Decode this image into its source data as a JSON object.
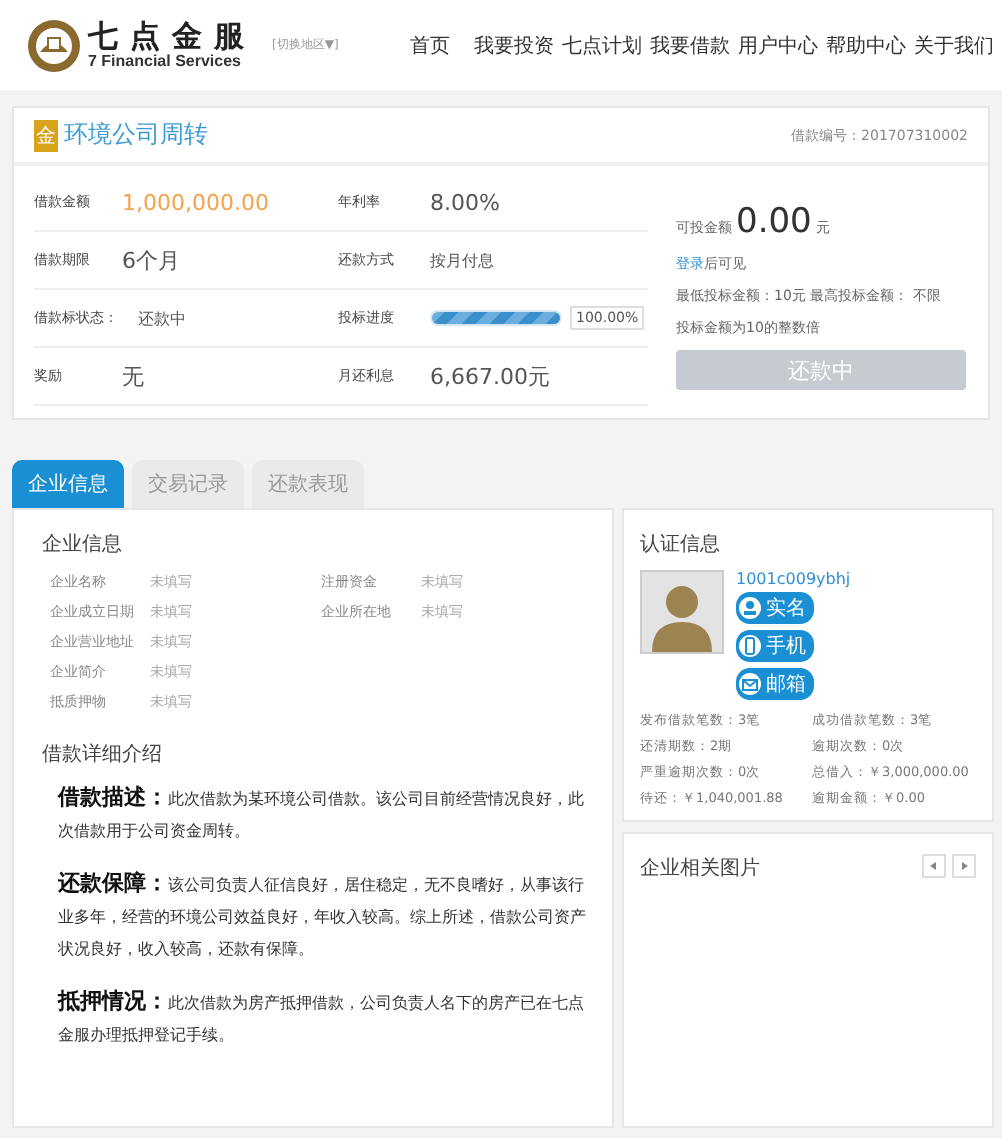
{
  "header": {
    "logo_title": "七点金服",
    "logo_subtitle": "7 Financial Services",
    "region": "[切换地区▼]",
    "nav": [
      {
        "label": "首页"
      },
      {
        "label": "我要投资"
      },
      {
        "label": "七点计划"
      },
      {
        "label": "我要借款"
      },
      {
        "label": "用户中心"
      },
      {
        "label": "帮助中心"
      },
      {
        "label": "关于我们"
      }
    ]
  },
  "loan": {
    "badge": "金",
    "title": "环境公司周转",
    "number_label": "借款编号：",
    "number": "201707310002",
    "fields": [
      {
        "kind": "amount",
        "label": "借款金额",
        "value": "1,000,000.00"
      },
      {
        "kind": "large",
        "label": "年利率",
        "value": "8.00%"
      },
      {
        "kind": "large",
        "label": "借款期限",
        "value": "6个月"
      },
      {
        "kind": "text",
        "label": "还款方式",
        "value": "按月付息"
      },
      {
        "kind": "text",
        "label": "借款标状态：",
        "value": "还款中"
      },
      {
        "kind": "progress",
        "label": "投标进度",
        "level": 1,
        "reading": "100.00%"
      },
      {
        "kind": "large",
        "label": "奖励",
        "value": "无"
      },
      {
        "kind": "large",
        "label": "月还利息",
        "value": "6,667.00元"
      }
    ],
    "available_label": "可投金额",
    "available": "0.00",
    "unit": "元",
    "login_link": "登录",
    "login_suffix": "后可见",
    "limits": "最低投标金额：10元 最高投标金额： 不限",
    "note": "投标金额为10的整数倍",
    "button": {
      "label": "还款中",
      "disabled": true
    }
  },
  "tabs": [
    {
      "label": "企业信息",
      "selected": true
    },
    {
      "label": "交易记录",
      "selected": false
    },
    {
      "label": "还款表现",
      "selected": false
    }
  ],
  "company": {
    "title": "企业信息",
    "rows": [
      [
        {
          "label": "企业名称",
          "value": "未填写"
        },
        {
          "label": "注册资金",
          "value": "未填写"
        }
      ],
      [
        {
          "label": "企业成立日期",
          "value": "未填写"
        },
        {
          "label": "企业所在地",
          "value": "未填写"
        }
      ],
      [
        {
          "label": "企业营业地址",
          "value": "未填写"
        }
      ],
      [
        {
          "label": "企业简介",
          "value": "未填写"
        }
      ],
      [
        {
          "label": "抵质押物",
          "value": "未填写"
        }
      ]
    ]
  },
  "details": {
    "title": "借款详细介绍",
    "paragraphs": [
      {
        "heading": "借款描述：",
        "text": "此次借款为某环境公司借款。该公司目前经营情况良好，此次借款用于公司资金周转。"
      },
      {
        "heading": "还款保障：",
        "text": "该公司负责人征信良好，居住稳定，无不良嗜好，从事该行业多年，经营的环境公司效益良好，年收入较高。综上所述，借款公司资产状况良好，收入较高，还款有保障。"
      },
      {
        "heading": "抵押情况：",
        "text": "此次借款为房产抵押借款，公司负责人名下的房产已在七点金服办理抵押登记手续。"
      }
    ]
  },
  "certification": {
    "title": "认证信息",
    "username": "1001c009ybhj",
    "badges": [
      {
        "kind": "person",
        "label": "实名"
      },
      {
        "kind": "phone",
        "label": "手机"
      },
      {
        "kind": "mail",
        "label": "邮箱"
      }
    ],
    "stats": [
      {
        "label": "发布借款笔数：",
        "value": "3笔"
      },
      {
        "label": "成功借款笔数：",
        "value": "3笔"
      },
      {
        "label": "还清期数：",
        "value": "2期"
      },
      {
        "label": "逾期次数：",
        "value": "0次"
      },
      {
        "label": "严重逾期次数：",
        "value": "0次"
      },
      {
        "label": "总借入：",
        "value": "￥3,000,000.00"
      },
      {
        "label": "待还：",
        "value": "￥1,040,001.88"
      },
      {
        "label": "逾期金额：",
        "value": "￥0.00"
      }
    ]
  },
  "pictures": {
    "title": "企业相关图片"
  }
}
